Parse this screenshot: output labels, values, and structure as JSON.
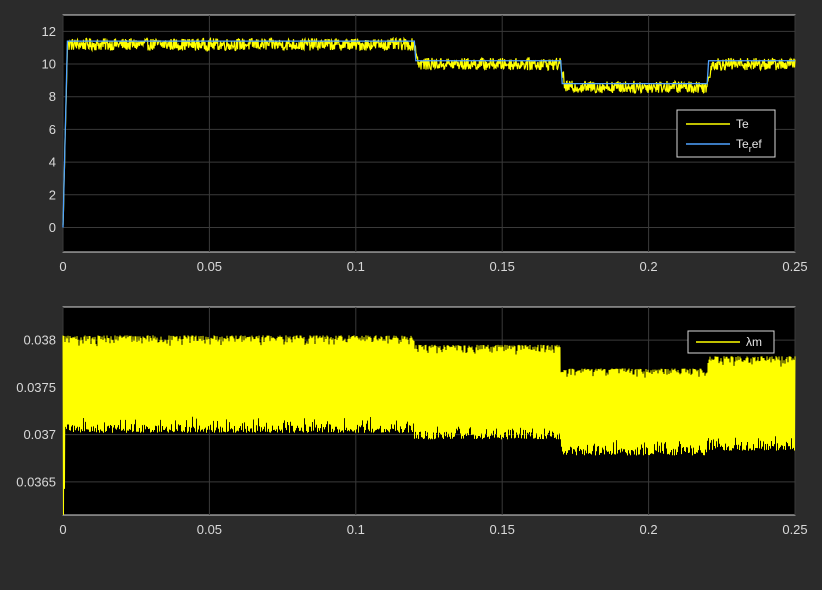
{
  "chart_data": [
    {
      "type": "line",
      "title": "",
      "xlabel": "",
      "ylabel": "",
      "xlim": [
        0,
        0.25
      ],
      "ylim": [
        -1.5,
        13
      ],
      "xticks": [
        "0",
        "0.05",
        "0.1",
        "0.15",
        "0.2",
        "0.25"
      ],
      "yticks": [
        "0",
        "2",
        "4",
        "6",
        "8",
        "10",
        "12"
      ],
      "grid": true,
      "legend_position": "right",
      "series": [
        {
          "name": "Te",
          "color": "#ffff00",
          "style": "noisy",
          "noise_band": 0.75,
          "steps": [
            [
              0,
              0
            ],
            [
              0.0015,
              11.2
            ],
            [
              0.12,
              11.2
            ],
            [
              0.1215,
              10.0
            ],
            [
              0.17,
              10.0
            ],
            [
              0.1715,
              8.6
            ],
            [
              0.22,
              8.6
            ],
            [
              0.2215,
              10.0
            ],
            [
              0.25,
              10.0
            ]
          ]
        },
        {
          "name": "Te_ref",
          "label": "Te",
          "label_sub": "r",
          "label_tail": "ef",
          "color": "#4fa3ff",
          "style": "clean",
          "steps": [
            [
              0,
              0
            ],
            [
              0.0015,
              11.4
            ],
            [
              0.12,
              11.4
            ],
            [
              0.1205,
              10.2
            ],
            [
              0.17,
              10.2
            ],
            [
              0.1705,
              8.8
            ],
            [
              0.22,
              8.8
            ],
            [
              0.2205,
              10.2
            ],
            [
              0.25,
              10.2
            ]
          ]
        }
      ]
    },
    {
      "type": "line",
      "title": "",
      "xlabel": "",
      "ylabel": "",
      "xlim": [
        0,
        0.25
      ],
      "ylim": [
        0.03615,
        0.03835
      ],
      "xticks": [
        "0",
        "0.05",
        "0.1",
        "0.15",
        "0.2",
        "0.25"
      ],
      "yticks": [
        "0.0365",
        "0.037",
        "0.0375",
        "0.038"
      ],
      "ytick_values": [
        0.0365,
        0.037,
        0.0375,
        0.038
      ],
      "grid": true,
      "legend_position": "top-right",
      "series": [
        {
          "name": "λm",
          "color": "#ffff00",
          "style": "noisy",
          "band": [
            [
              0,
              0.03702,
              0.03805
            ],
            [
              0.12,
              0.03695,
              0.03795
            ],
            [
              0.17,
              0.03678,
              0.0377
            ],
            [
              0.22,
              0.03683,
              0.03783
            ],
            [
              0.25,
              0.03683,
              0.03783
            ]
          ]
        }
      ]
    }
  ]
}
